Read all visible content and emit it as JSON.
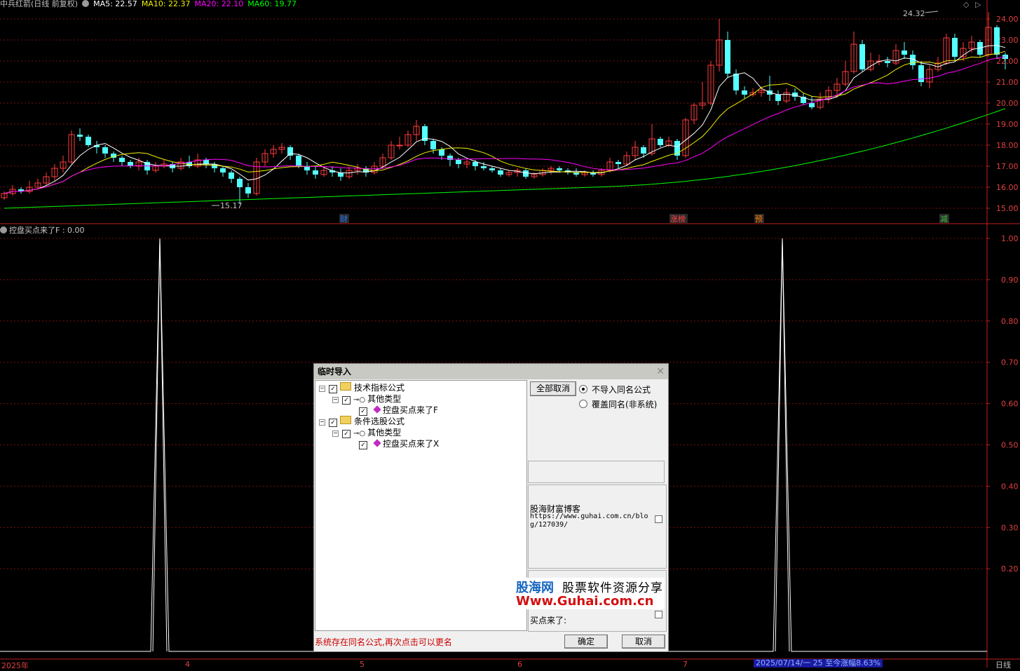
{
  "header": {
    "title": "中兵红箭(日线 前复权)",
    "ma5": "MA5: 22.57",
    "ma10": "MA10: 22.37",
    "ma20": "MA20: 22.10",
    "ma60": "MA60: 19.77",
    "ma5_color": "#ffffff",
    "ma10_color": "#f0f000",
    "ma20_color": "#ff00ff",
    "ma60_color": "#00ff00"
  },
  "price_axis": {
    "labels": [
      "24.00",
      "23.00",
      "22.00",
      "21.00",
      "20.00",
      "19.00",
      "18.00",
      "17.00",
      "16.00",
      "15.00"
    ],
    "high_marker": "24.32",
    "low_marker": "15.17"
  },
  "event_markers": [
    {
      "label": "财",
      "color": "#1e78ff"
    },
    {
      "label": "涨榜",
      "color": "#ff4040"
    },
    {
      "label": "预",
      "color": "#ff7a00"
    },
    {
      "label": "减",
      "color": "#3cc040"
    }
  ],
  "indicator": {
    "header": "控盘买点来了F : 0.00",
    "axis_labels": [
      "1.00",
      "0.90",
      "0.80",
      "0.70",
      "0.60",
      "0.50",
      "0.40",
      "0.30",
      "0.20"
    ]
  },
  "x_axis": {
    "labels": [
      "2025年",
      "4",
      "5",
      "6",
      "7"
    ],
    "status": "2025/07/14/一 25 至今涨幅8.63%",
    "period": "日线"
  },
  "dialog": {
    "title": "临时导入",
    "tree": [
      {
        "label": "技术指标公式"
      },
      {
        "label": "其他类型"
      },
      {
        "label": "控盘买点来了F"
      },
      {
        "label": "条件选股公式"
      },
      {
        "label": "其他类型"
      },
      {
        "label": "控盘买点来了X"
      }
    ],
    "cancel_all": "全部取消",
    "radio_no_import": "不导入同名公式",
    "radio_overwrite": "覆盖同名(非系统)",
    "blog_name": "股海财富博客",
    "blog_url": "https://www.guhai.com.cn/blog/127039/",
    "buy_text": "买点来了:",
    "error": "系统存在同名公式,再次点击可以更名",
    "ok": "确定",
    "cancel": "取消"
  },
  "watermark": {
    "brand": "股海网",
    "slogan": "股票软件资源分享",
    "url": "Www.Guhai.com.cn"
  },
  "chart_data": [
    {
      "type": "candlestick",
      "title": "中兵红箭(日线 前复权)",
      "ylim": [
        14.8,
        24.4
      ],
      "series": [
        {
          "name": "MA5",
          "values": [
            22.57
          ]
        },
        {
          "name": "MA10",
          "values": [
            22.37
          ]
        },
        {
          "name": "MA20",
          "values": [
            22.1
          ]
        },
        {
          "name": "MA60",
          "values": [
            19.77
          ]
        }
      ],
      "high": 24.32,
      "low": 15.17,
      "candles": [
        [
          15.5,
          15.7,
          15.4,
          15.8
        ],
        [
          15.7,
          15.9,
          15.6,
          16.1
        ],
        [
          15.9,
          15.8,
          15.7,
          16.0
        ],
        [
          15.8,
          16.0,
          15.7,
          16.3
        ],
        [
          16.0,
          16.2,
          15.9,
          16.4
        ],
        [
          16.2,
          16.5,
          16.1,
          16.7
        ],
        [
          16.5,
          16.9,
          16.3,
          17.1
        ],
        [
          16.9,
          17.2,
          16.7,
          17.5
        ],
        [
          17.2,
          18.5,
          17.1,
          18.7
        ],
        [
          18.5,
          18.4,
          18.2,
          18.8
        ],
        [
          18.4,
          18.0,
          17.9,
          18.5
        ],
        [
          18.0,
          17.9,
          17.6,
          18.2
        ],
        [
          17.9,
          17.6,
          17.4,
          18.0
        ],
        [
          17.6,
          17.4,
          17.2,
          17.7
        ],
        [
          17.4,
          17.2,
          17.0,
          17.5
        ],
        [
          17.2,
          17.0,
          16.9,
          17.3
        ],
        [
          17.0,
          17.2,
          16.8,
          17.4
        ],
        [
          17.2,
          16.8,
          16.6,
          17.3
        ],
        [
          16.8,
          17.0,
          16.7,
          17.2
        ],
        [
          17.0,
          17.1,
          16.9,
          17.3
        ],
        [
          17.1,
          16.9,
          16.7,
          17.2
        ],
        [
          16.9,
          17.2,
          16.8,
          17.4
        ],
        [
          17.2,
          17.0,
          16.9,
          17.5
        ],
        [
          17.0,
          17.3,
          16.9,
          17.6
        ],
        [
          17.3,
          17.1,
          16.9,
          17.4
        ],
        [
          17.1,
          16.9,
          16.7,
          17.2
        ],
        [
          16.9,
          16.7,
          16.5,
          17.0
        ],
        [
          16.7,
          16.4,
          16.2,
          16.8
        ],
        [
          16.4,
          16.0,
          15.2,
          16.5
        ],
        [
          16.0,
          15.7,
          15.5,
          16.2
        ],
        [
          15.7,
          17.2,
          15.6,
          17.4
        ],
        [
          17.2,
          17.6,
          17.0,
          17.8
        ],
        [
          17.6,
          17.8,
          17.4,
          18.0
        ],
        [
          17.8,
          17.9,
          17.6,
          18.1
        ],
        [
          17.9,
          17.5,
          17.3,
          18.0
        ],
        [
          17.5,
          17.0,
          16.9,
          17.6
        ],
        [
          17.0,
          16.8,
          16.6,
          17.2
        ],
        [
          16.8,
          16.6,
          16.4,
          17.0
        ],
        [
          16.6,
          16.8,
          16.5,
          17.0
        ],
        [
          16.8,
          16.7,
          16.5,
          17.0
        ],
        [
          16.7,
          16.5,
          16.3,
          16.9
        ],
        [
          16.5,
          16.8,
          16.4,
          17.0
        ],
        [
          16.8,
          16.9,
          16.6,
          17.1
        ],
        [
          16.9,
          16.7,
          16.5,
          17.0
        ],
        [
          16.7,
          17.0,
          16.6,
          17.2
        ],
        [
          17.0,
          17.4,
          16.9,
          17.6
        ],
        [
          17.4,
          18.0,
          17.3,
          18.2
        ],
        [
          18.0,
          18.0,
          17.8,
          18.4
        ],
        [
          18.0,
          18.5,
          17.9,
          18.7
        ],
        [
          18.5,
          18.9,
          18.2,
          19.2
        ],
        [
          18.9,
          18.2,
          18.0,
          19.0
        ],
        [
          18.2,
          17.8,
          17.6,
          18.3
        ],
        [
          17.8,
          17.5,
          17.3,
          17.9
        ],
        [
          17.5,
          17.3,
          17.0,
          17.6
        ],
        [
          17.3,
          17.1,
          16.9,
          17.4
        ],
        [
          17.1,
          17.2,
          16.9,
          17.3
        ],
        [
          17.2,
          17.0,
          16.8,
          17.3
        ],
        [
          17.0,
          16.9,
          16.8,
          17.2
        ],
        [
          16.9,
          16.8,
          16.7,
          17.0
        ],
        [
          16.8,
          16.6,
          16.5,
          16.9
        ],
        [
          16.6,
          16.7,
          16.5,
          16.8
        ],
        [
          16.7,
          16.8,
          16.5,
          16.9
        ],
        [
          16.8,
          16.5,
          16.4,
          16.9
        ],
        [
          16.5,
          16.6,
          16.4,
          16.7
        ],
        [
          16.6,
          16.8,
          16.5,
          16.9
        ],
        [
          16.8,
          16.9,
          16.6,
          17.0
        ],
        [
          16.9,
          16.8,
          16.7,
          17.0
        ],
        [
          16.8,
          16.7,
          16.6,
          16.9
        ],
        [
          16.7,
          16.6,
          16.5,
          16.9
        ],
        [
          16.6,
          16.7,
          16.5,
          16.8
        ],
        [
          16.7,
          16.6,
          16.5,
          16.8
        ],
        [
          16.6,
          16.8,
          16.5,
          16.9
        ],
        [
          16.8,
          17.2,
          16.7,
          17.4
        ],
        [
          17.2,
          17.1,
          16.9,
          17.3
        ],
        [
          17.1,
          17.5,
          17.0,
          17.7
        ],
        [
          17.5,
          17.9,
          17.3,
          18.2
        ],
        [
          17.9,
          17.6,
          17.4,
          18.0
        ],
        [
          17.6,
          18.3,
          17.5,
          19.0
        ],
        [
          18.3,
          18.0,
          17.9,
          18.4
        ],
        [
          18.0,
          18.2,
          17.9,
          18.4
        ],
        [
          18.2,
          17.5,
          17.3,
          18.3
        ],
        [
          17.5,
          19.2,
          17.4,
          19.3
        ],
        [
          19.2,
          19.9,
          19.0,
          20.0
        ],
        [
          19.9,
          20.0,
          19.7,
          21.0
        ],
        [
          20.0,
          21.8,
          19.9,
          22.0
        ],
        [
          21.8,
          23.0,
          21.5,
          24.0
        ],
        [
          23.0,
          21.4,
          21.2,
          23.4
        ],
        [
          21.4,
          20.6,
          20.4,
          21.6
        ],
        [
          20.6,
          20.4,
          20.2,
          20.8
        ],
        [
          20.4,
          20.5,
          20.3,
          20.7
        ],
        [
          20.5,
          20.6,
          20.3,
          20.8
        ],
        [
          20.6,
          20.4,
          20.1,
          21.3
        ],
        [
          20.4,
          20.1,
          19.9,
          20.6
        ],
        [
          20.1,
          20.5,
          20.0,
          20.7
        ],
        [
          20.5,
          20.3,
          20.1,
          20.7
        ],
        [
          20.3,
          20.0,
          19.9,
          20.5
        ],
        [
          20.0,
          19.8,
          19.7,
          20.3
        ],
        [
          19.8,
          20.2,
          19.7,
          20.5
        ],
        [
          20.2,
          20.6,
          20.0,
          20.8
        ],
        [
          20.6,
          20.9,
          20.4,
          21.2
        ],
        [
          20.9,
          21.5,
          20.8,
          22.0
        ],
        [
          21.5,
          22.8,
          21.4,
          23.4
        ],
        [
          22.8,
          21.6,
          21.5,
          23.0
        ],
        [
          21.6,
          22.0,
          21.5,
          22.4
        ],
        [
          22.0,
          22.0,
          21.8,
          22.3
        ],
        [
          22.0,
          21.9,
          21.7,
          22.2
        ],
        [
          21.9,
          22.5,
          21.8,
          22.8
        ],
        [
          22.5,
          22.3,
          22.1,
          22.9
        ],
        [
          22.3,
          21.8,
          21.6,
          22.5
        ],
        [
          21.8,
          21.0,
          20.8,
          22.0
        ],
        [
          21.0,
          21.6,
          20.7,
          21.8
        ],
        [
          21.6,
          21.9,
          21.5,
          22.2
        ],
        [
          21.9,
          23.1,
          21.8,
          23.3
        ],
        [
          23.1,
          22.2,
          22.0,
          23.3
        ],
        [
          22.2,
          22.6,
          22.0,
          22.9
        ],
        [
          22.6,
          22.9,
          22.4,
          23.2
        ],
        [
          22.9,
          22.3,
          22.2,
          23.0
        ],
        [
          22.3,
          23.6,
          22.2,
          24.32
        ],
        [
          23.6,
          22.3,
          22.1,
          23.7
        ],
        [
          22.3,
          22.1,
          21.6,
          22.4
        ]
      ]
    },
    {
      "type": "line",
      "title": "控盘买点来了F",
      "ylim": [
        0,
        1.0
      ],
      "series": [
        {
          "name": "控盘买点来了F",
          "x": [
            228,
            1116
          ],
          "values": [
            1.0,
            1.0
          ]
        }
      ]
    }
  ]
}
